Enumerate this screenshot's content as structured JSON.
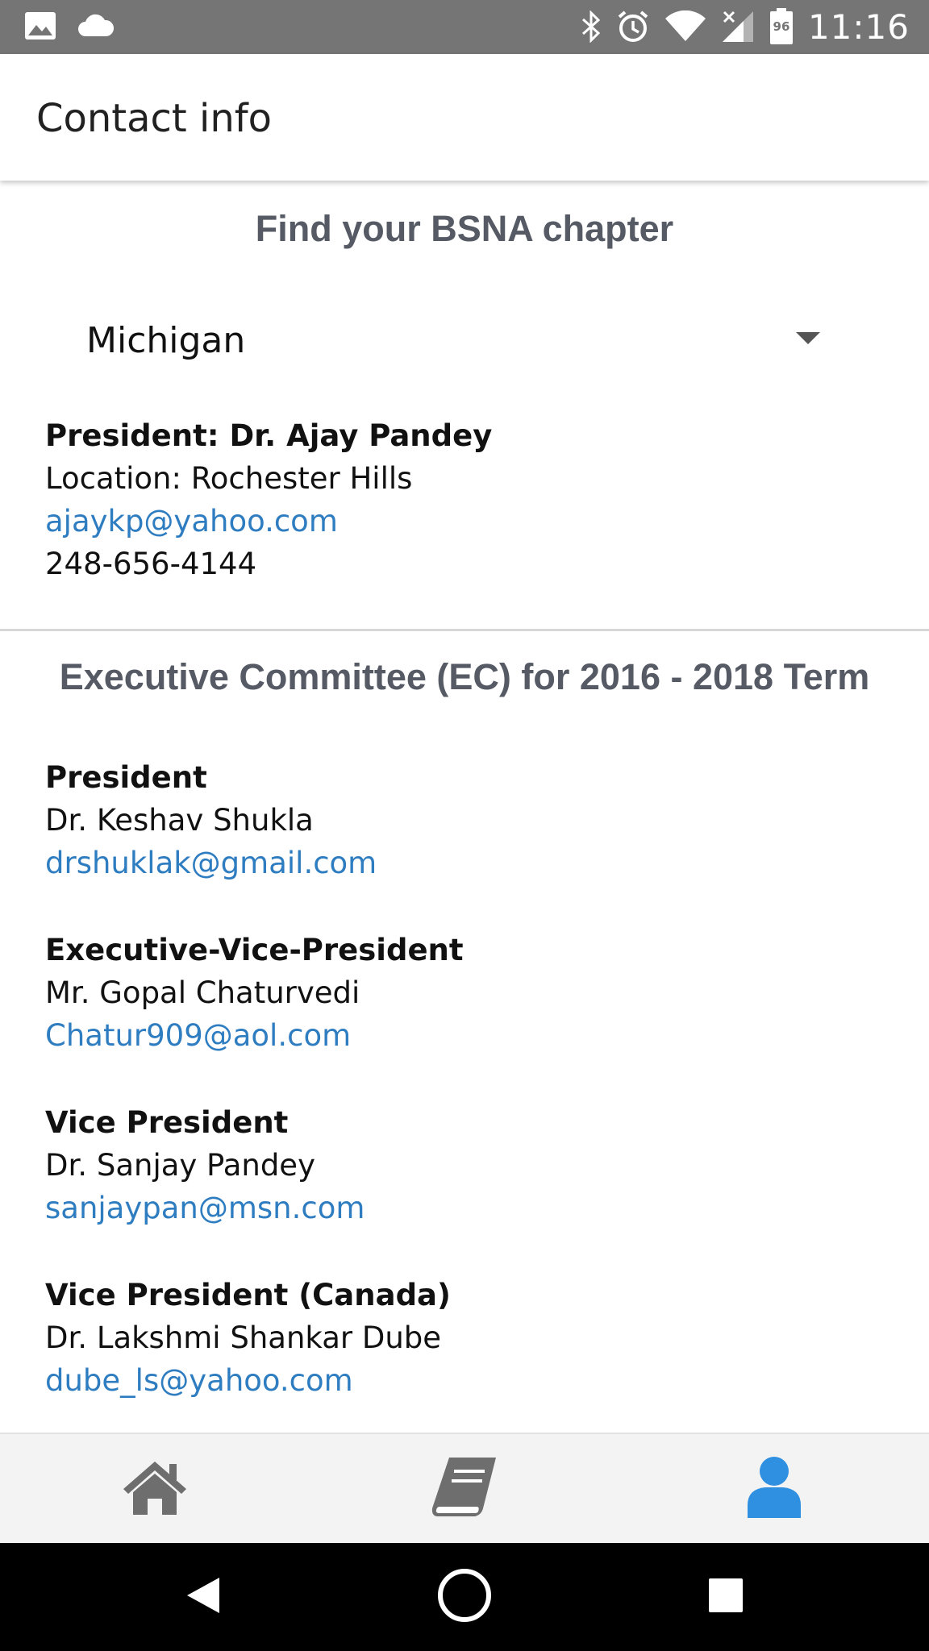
{
  "status_bar": {
    "time": "11:16",
    "battery": "96",
    "left_icons": [
      "image-icon",
      "cloud-icon"
    ],
    "right_icons": [
      "bluetooth-icon",
      "alarm-icon",
      "wifi-icon",
      "signal-icon",
      "battery-icon"
    ]
  },
  "app_bar": {
    "title": "Contact info"
  },
  "chapter": {
    "heading": "Find your BSNA chapter",
    "selected_state": "Michigan",
    "president": "President: Dr. Ajay Pandey",
    "location": "Location: Rochester Hills",
    "email": "ajaykp@yahoo.com",
    "phone": "248-656-4144"
  },
  "executive_committee": {
    "heading": "Executive Committee (EC) for 2016 - 2018 Term",
    "members": [
      {
        "role": "President",
        "name": "Dr. Keshav Shukla",
        "email": "drshuklak@gmail.com"
      },
      {
        "role": "Executive-Vice-President",
        "name": "Mr. Gopal Chaturvedi",
        "email": "Chatur909@aol.com"
      },
      {
        "role": "Vice President",
        "name": "Dr. Sanjay Pandey",
        "email": "sanjaypan@msn.com"
      },
      {
        "role": "Vice President (Canada)",
        "name": "Dr. Lakshmi Shankar Dube",
        "email": "dube_ls@yahoo.com"
      }
    ]
  },
  "bottom_nav": {
    "tabs": [
      {
        "icon": "home-icon",
        "active": false
      },
      {
        "icon": "book-icon",
        "active": false
      },
      {
        "icon": "person-icon",
        "active": true
      }
    ]
  },
  "colors": {
    "status_bar": "#757575",
    "heading": "#555a64",
    "link": "#2f7dc1",
    "active_tab": "#2f8fe0",
    "inactive_tab": "#6e6e6e",
    "bottom_nav_bg": "#f3f3f3"
  }
}
